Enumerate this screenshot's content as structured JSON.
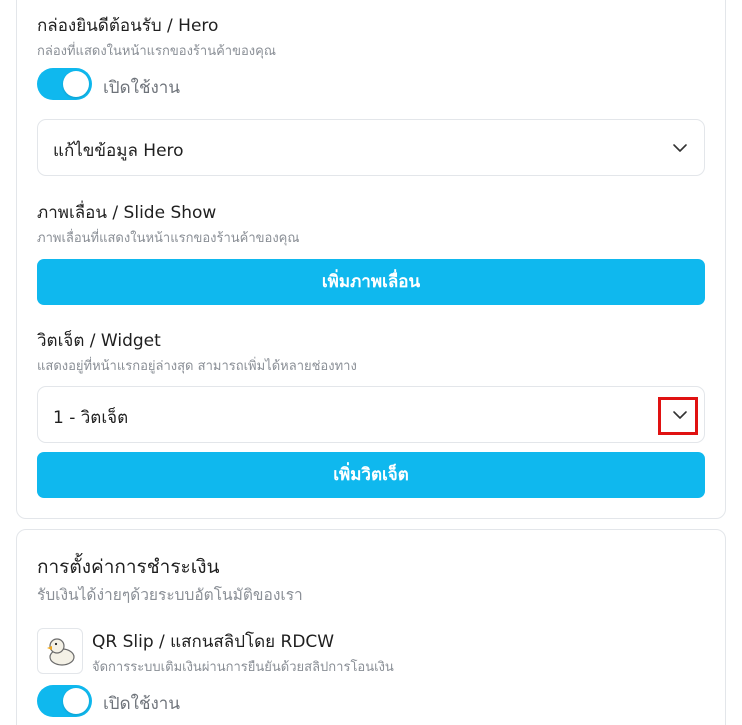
{
  "hero": {
    "title": "กล่องยินดีต้อนรับ / Hero",
    "subtitle": "กล่องที่แสดงในหน้าแรกของร้านค้าของคุณ",
    "toggle_label": "เปิดใช้งาน",
    "toggle_on": true,
    "edit_label": "แก้ไขข้อมูล Hero"
  },
  "slideshow": {
    "title": "ภาพเลื่อน / Slide Show",
    "subtitle": "ภาพเลื่อนที่แสดงในหน้าแรกของร้านค้าของคุณ",
    "add_button": "เพิ่มภาพเลื่อน"
  },
  "widget": {
    "title": "วิตเจ็ต / Widget",
    "subtitle": "แสดงอยู่ที่หน้าแรกอยู่ล่างสุด สามารถเพิ่มได้หลายช่องทาง",
    "items": [
      {
        "label": "1 - วิตเจ็ต"
      }
    ],
    "add_button": "เพิ่มวิตเจ็ต"
  },
  "payment": {
    "title": "การตั้งค่าการชำระเงิน",
    "subtitle": "รับเงินได้ง่ายๆด้วยระบบอัตโนมัติของเรา",
    "methods": [
      {
        "name": "QR Slip / แสกนสลิปโดย RDCW",
        "description": "จัดการระบบเติมเงินผ่านการยืนยันด้วยสลิปการโอนเงิน",
        "icon": "duck-logo-icon",
        "toggle_label": "เปิดใช้งาน",
        "toggle_on": true
      }
    ]
  },
  "colors": {
    "accent": "#0fb8ee",
    "highlight": "#e01212"
  }
}
